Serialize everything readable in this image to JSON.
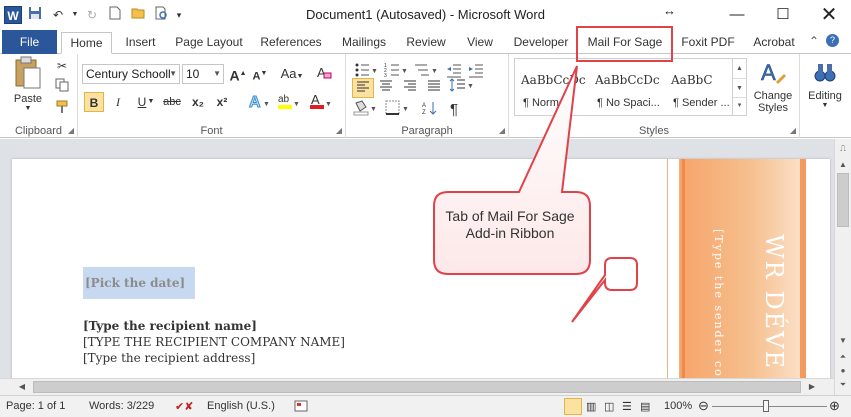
{
  "titlebar": {
    "app_logo": "W",
    "title": "Document1 (Autosaved)  -  Microsoft Word",
    "quick_access": [
      "save-icon",
      "undo-icon",
      "redo-icon",
      "new-doc-icon",
      "open-icon",
      "print-preview-icon",
      "customize-qat-icon"
    ],
    "controls": {
      "minimize": "—",
      "maximize": "☐",
      "close": "✕"
    },
    "resize_glyph": "↔"
  },
  "tabs": {
    "file": "File",
    "items": [
      "Home",
      "Insert",
      "Page Layout",
      "References",
      "Mailings",
      "Review",
      "View",
      "Developer",
      "Mail For Sage",
      "Foxit PDF",
      "Acrobat"
    ],
    "active": "Home"
  },
  "ribbon": {
    "clipboard": {
      "label": "Clipboard",
      "paste": "Paste"
    },
    "font": {
      "label": "Font",
      "family": "Century Schooll",
      "size": "10",
      "bold": "B",
      "italic": "I",
      "underline": "U",
      "strike": "abc",
      "subscript": "x₂",
      "superscript": "x²",
      "grow": "A",
      "shrink": "A",
      "change_case": "Aa",
      "clear": "A"
    },
    "paragraph": {
      "label": "Paragraph",
      "pilcrow": "¶"
    },
    "styles": {
      "label": "Styles",
      "items": [
        {
          "sample": "AaBbCcDc",
          "name": "¶ Normal"
        },
        {
          "sample": "AaBbCcDc",
          "name": "¶ No Spaci..."
        },
        {
          "sample": "AaBbC",
          "name": "¶ Sender ..."
        }
      ],
      "change_styles": "Change Styles"
    },
    "editing": {
      "label": "Editing"
    }
  },
  "document": {
    "pick_date": "[Pick the date]",
    "recipient_name": "[Type the recipient name]",
    "recipient_company": "[TYPE THE RECIPIENT COMPANY NAME]",
    "recipient_address": "[Type the recipient address]",
    "sidebar_title": "WR DÉVE",
    "sidebar_sub": "[Type the sender co"
  },
  "status": {
    "page": "Page: 1 of 1",
    "words": "Words: 3/229",
    "language": "English (U.S.)",
    "zoom": "100%",
    "zoom_level": 1.0
  },
  "annotation": {
    "callout": "Tab of Mail For Sage Add-in Ribbon",
    "color": "#e0424a"
  },
  "colors": {
    "word_blue": "#2b579a",
    "sidebar_orange": "#f7a46a",
    "selection": "#c6d9f1"
  }
}
